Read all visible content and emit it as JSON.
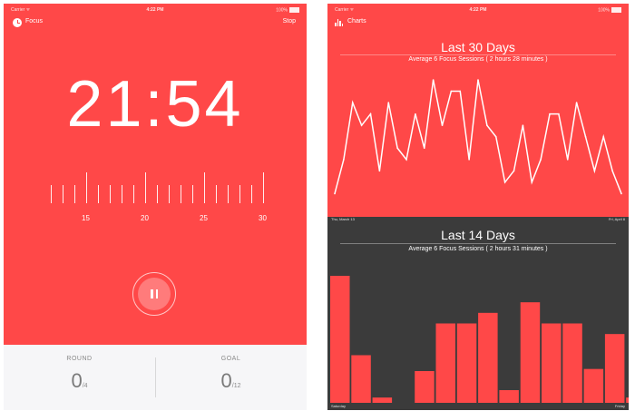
{
  "left_screen": {
    "status": {
      "carrier": "Carrier ᯤ",
      "time": "4:22 PM",
      "battery": "100%"
    },
    "nav": {
      "title": "Focus",
      "stop_label": "Stop"
    },
    "timer": "21:54",
    "ruler_labels": [
      "15",
      "20",
      "25",
      "30"
    ],
    "round": {
      "label": "ROUND",
      "value": "0",
      "total": "/4"
    },
    "goal": {
      "label": "GOAL",
      "value": "0",
      "total": "/12"
    }
  },
  "right_screen": {
    "status": {
      "carrier": "Carrier ᯤ",
      "time": "4:22 PM",
      "battery": "100%"
    },
    "nav": {
      "title": "Charts"
    },
    "colors": {
      "accent": "#ff4848",
      "dark": "#3b3b3b"
    },
    "chart30": {
      "title": "Last 30 Days",
      "subtitle": "Average 6 Focus Sessions ( 2 hours 28 minutes )",
      "start_label": "Thu, March 13",
      "end_label": "Fri, April 8",
      "values": [
        1,
        4,
        9,
        7,
        8,
        3,
        9,
        5,
        4,
        8,
        5,
        11,
        7,
        10,
        10,
        4,
        11,
        7,
        6,
        2,
        3,
        7,
        2,
        4,
        8,
        8,
        4,
        9,
        6,
        3,
        6,
        3,
        1
      ]
    },
    "chart14": {
      "title": "Last 14 Days",
      "subtitle": "Average 6 Focus Sessions ( 2 hours 31 minutes )",
      "start_label": "Saturday",
      "end_label": "Friday",
      "values": [
        12,
        4.5,
        0.5,
        0,
        3,
        7.5,
        7.5,
        8.5,
        1.2,
        9.5,
        7.5,
        7.5,
        3.2,
        6.5,
        0.5
      ]
    }
  }
}
